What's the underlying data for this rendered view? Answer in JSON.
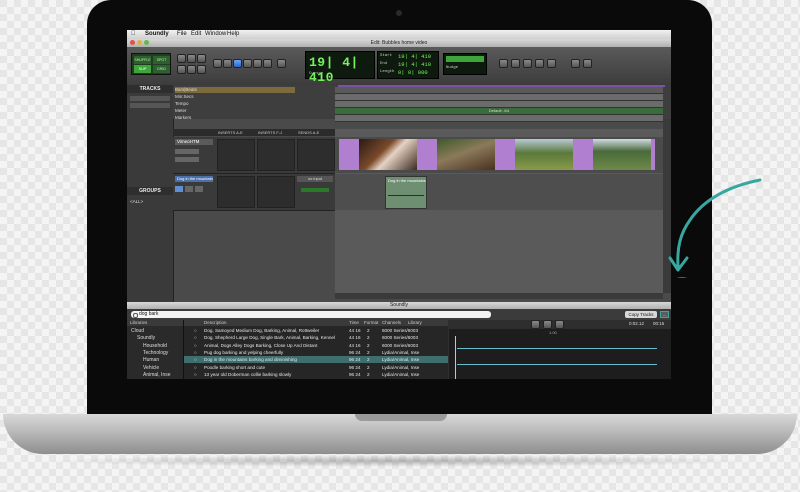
{
  "menubar": {
    "items": [
      "Soundly",
      "File",
      "Edit",
      "Window",
      "Help"
    ]
  },
  "edit_window": {
    "title": "Edit: Bubbles home video",
    "counter": "19| 4| 410",
    "counter_labels": [
      "Start",
      "End",
      "Length"
    ],
    "counter_values": [
      "19| 4| 410",
      "19| 4| 410",
      "0| 0| 000"
    ],
    "toolbar_labels": [
      "SHUFFLE",
      "SPOT",
      "SLIP",
      "GRID"
    ],
    "main_counter_label": "Cursor",
    "nudge_label": "Nudge",
    "tracks_header": "TRACKS",
    "groups_header": "GROUPS",
    "ruler_rows": [
      "Bars|Beats",
      "Min:Secs",
      "Tempo",
      "Meter",
      "Markers"
    ],
    "meter_label": "Default: 4/4",
    "insert_headers": [
      "INSERTS A-E",
      "INSERTS F-J",
      "SENDS A-E"
    ],
    "video_track_name": "VimeoHTM",
    "audio_track_name": "Dog in the mountains",
    "audio_clip_label": "Dog in the mountains",
    "io_label": "no input",
    "group_all": "<ALL>"
  },
  "soundly": {
    "title": "Soundly",
    "search_value": "dog bark",
    "libraries_header": "Libraries",
    "libraries": [
      {
        "label": "Cloud",
        "indent": 0
      },
      {
        "label": "Soundly",
        "indent": 1
      },
      {
        "label": "Household",
        "indent": 2
      },
      {
        "label": "Technology",
        "indent": 2
      },
      {
        "label": "Human",
        "indent": 2
      },
      {
        "label": "Vehicle",
        "indent": 2
      },
      {
        "label": "Animal, Inse",
        "indent": 2
      }
    ],
    "columns": [
      "Description",
      "Time",
      "Format",
      "Channels",
      "Library"
    ],
    "results": [
      {
        "desc": "Dog, Samoyed Medium Dog, Barking, Animal, Rottweiler",
        "time": "44 16",
        "format": "2",
        "channels": "6000 Series/6003",
        "selected": false
      },
      {
        "desc": "Dog, Shepherd Large Dog, Single Bark, Animal, Barking, Kennel",
        "time": "44 16",
        "format": "2",
        "channels": "6000 Series/6003",
        "selected": false
      },
      {
        "desc": "Animal, Dogs Alley Dogs Barking, Close Up And Distant",
        "time": "44 16",
        "format": "2",
        "channels": "6000 Series/6003",
        "selected": false
      },
      {
        "desc": "Pug dog barking and yelping cheerfully",
        "time": "96 24",
        "format": "2",
        "channels": "Lydia/Animal, Inse",
        "selected": false
      },
      {
        "desc": "Dog in the mountains barking and diminishing",
        "time": "96 24",
        "format": "2",
        "channels": "Lydia/Animal, Inse",
        "selected": true
      },
      {
        "desc": "Poodle barking short and cute",
        "time": "96 24",
        "format": "2",
        "channels": "Lydia/Animal, Inse",
        "selected": false
      },
      {
        "desc": "13 year old Doberman collie barking slowly",
        "time": "96 24",
        "format": "2",
        "channels": "Lydia/Animal, Inse",
        "selected": false
      }
    ],
    "copy_button": "Copy Tracks",
    "waveform_time_left": "0:02.12",
    "waveform_time_right": "00:15",
    "waveform_marker": "1.00"
  },
  "colors": {
    "accent_green": "#74f35b",
    "video_clip_purple": "#b07fd0",
    "wave_blue": "#6bbbd0",
    "arrow_teal": "#3aa6a0"
  }
}
